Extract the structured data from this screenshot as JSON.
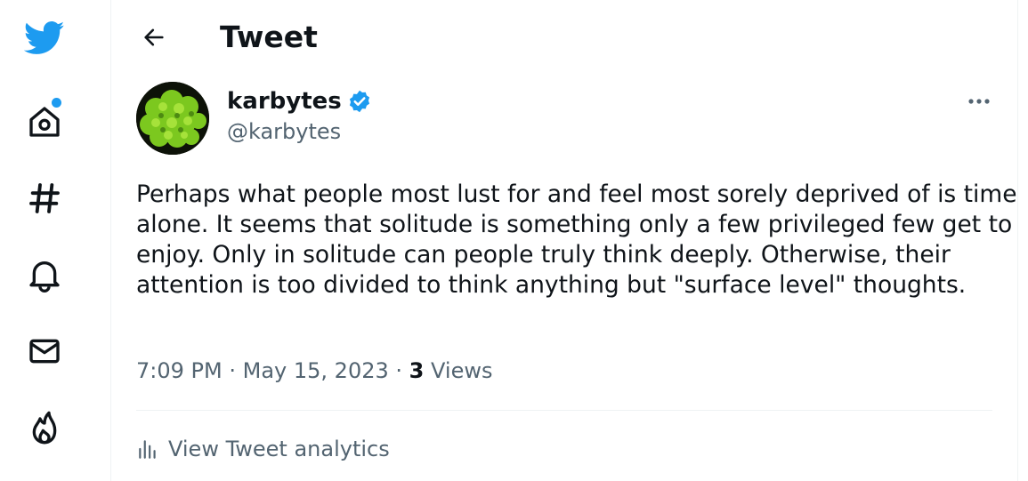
{
  "nav": {
    "logo_icon": "twitter-bird-icon",
    "items": [
      {
        "icon": "home-icon",
        "has_badge": true
      },
      {
        "icon": "explore-hashtag-icon"
      },
      {
        "icon": "notifications-bell-icon"
      },
      {
        "icon": "messages-envelope-icon"
      },
      {
        "icon": "trending-fire-icon"
      }
    ],
    "accent_color": "#1d9bf0"
  },
  "header": {
    "title": "Tweet",
    "back_icon": "arrow-left-icon"
  },
  "tweet": {
    "author_name": "karbytes",
    "author_handle": "@karbytes",
    "verified_icon": "verified-badge-icon",
    "more_icon": "more-dots-icon",
    "text": "Perhaps what people most lust for and feel most sorely deprived of is time alone. It seems that solitude is something only a few privileged few get to enjoy. Only in solitude can people truly think deeply. Otherwise, their attention is too divided to think anything but \"surface level\" thoughts.",
    "time": "7:09 PM",
    "date": "May 15, 2023",
    "separator": "·",
    "views_count": "3",
    "views_label": "Views"
  },
  "analytics": {
    "icon": "analytics-bars-icon",
    "label": "View Tweet analytics"
  }
}
